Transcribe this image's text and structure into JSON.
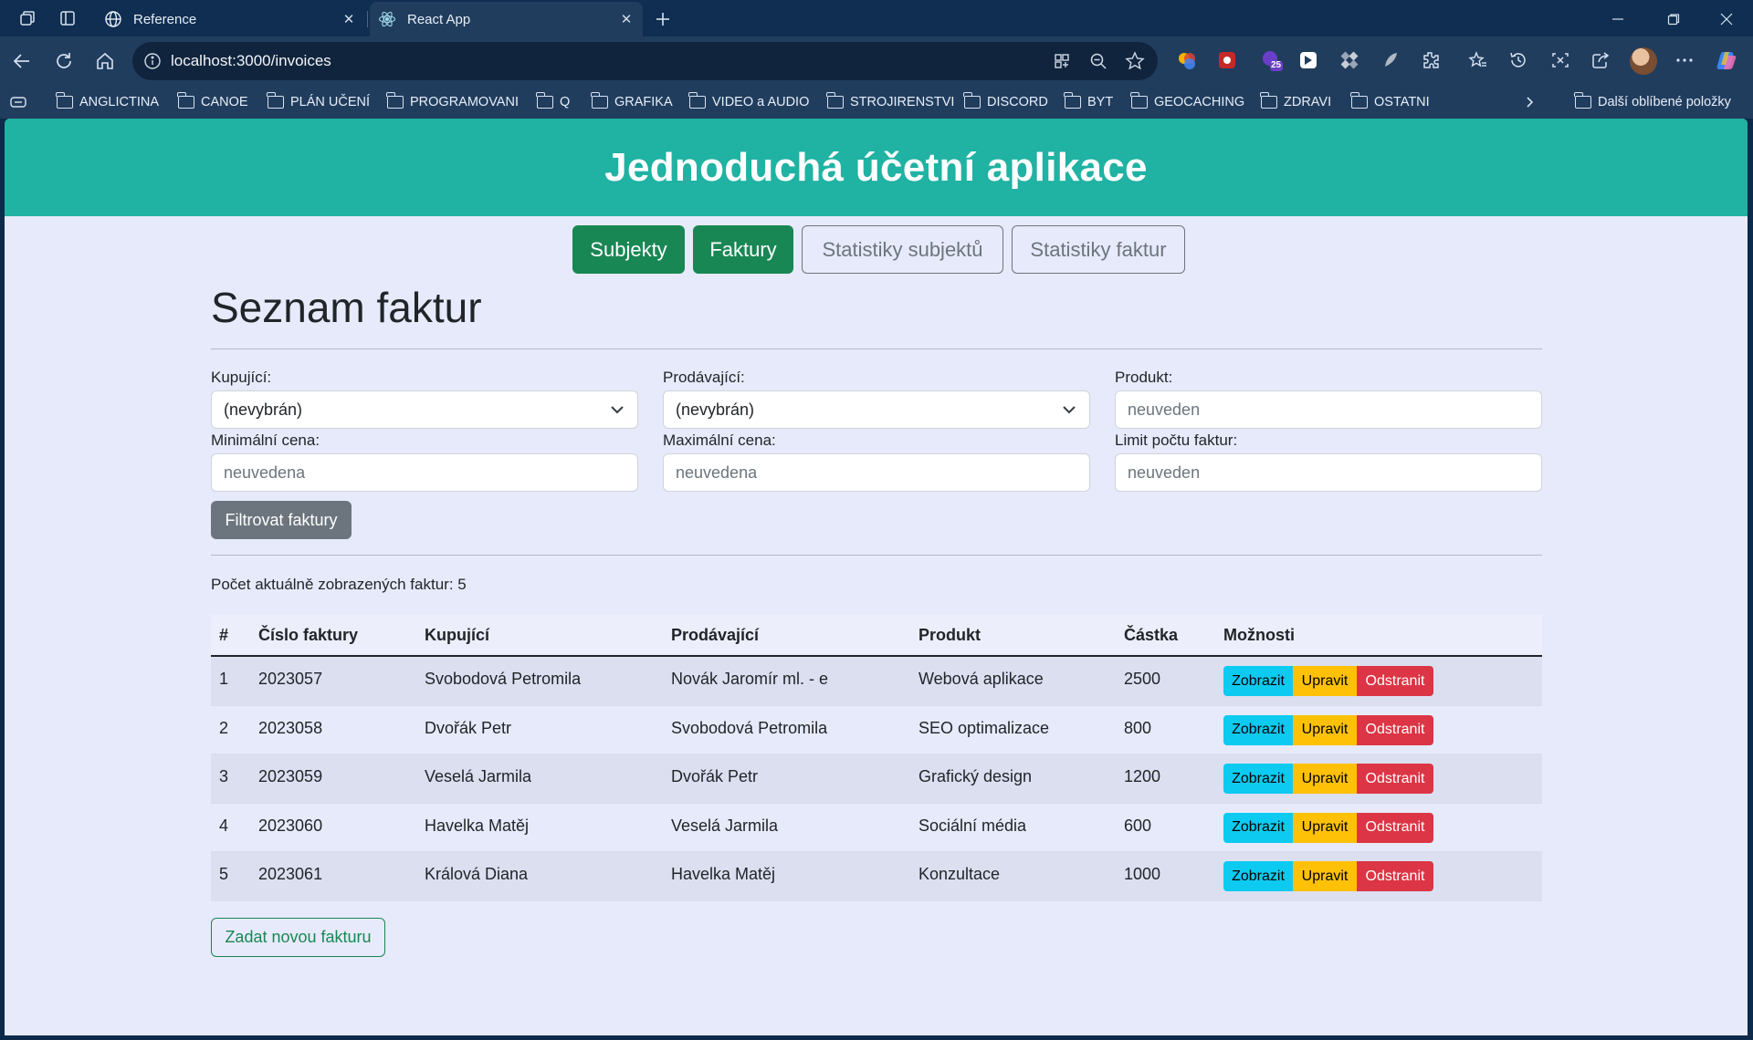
{
  "browser": {
    "tabs": [
      {
        "label": "Reference",
        "icon": "globe-icon",
        "active": false
      },
      {
        "label": "React App",
        "icon": "react-icon",
        "active": true
      }
    ],
    "address": "localhost:3000/invoices",
    "bookmarks": [
      "ANGLICTINA",
      "CANOE",
      "PLÁN UČENÍ",
      "PROGRAMOVANI",
      "Q",
      "GRAFIKA",
      "VIDEO a AUDIO",
      "STROJIRENSTVI",
      "DISCORD",
      "BYT",
      "GEOCACHING",
      "ZDRAVI",
      "OSTATNI"
    ],
    "other_bookmarks": "Další oblíbené položky",
    "extension_badge": "25"
  },
  "app": {
    "title": "Jednoduchá účetní aplikace",
    "nav": [
      "Subjekty",
      "Faktury",
      "Statistiky subjektů",
      "Statistiky faktur"
    ],
    "accent": "#198754",
    "header_color": "#20b2a2"
  },
  "page": {
    "heading": "Seznam faktur",
    "filters": {
      "buyer_label": "Kupující:",
      "buyer_value": "(nevybrán)",
      "seller_label": "Prodávající:",
      "seller_value": "(nevybrán)",
      "product_label": "Produkt:",
      "product_placeholder": "neuveden",
      "min_price_label": "Minimální cena:",
      "min_price_placeholder": "neuvedena",
      "max_price_label": "Maximální cena:",
      "max_price_placeholder": "neuvedena",
      "limit_label": "Limit počtu faktur:",
      "limit_placeholder": "neuveden",
      "submit": "Filtrovat faktury"
    },
    "count_text": "Počet aktuálně zobrazených faktur: 5",
    "table": {
      "headers": [
        "#",
        "Číslo faktury",
        "Kupující",
        "Prodávající",
        "Produkt",
        "Částka",
        "Možnosti"
      ],
      "rows": [
        [
          "1",
          "2023057",
          "Svobodová Petromila",
          "Novák Jaromír ml. - e",
          "Webová aplikace",
          "2500"
        ],
        [
          "2",
          "2023058",
          "Dvořák Petr",
          "Svobodová Petromila",
          "SEO optimalizace",
          "800"
        ],
        [
          "3",
          "2023059",
          "Veselá Jarmila",
          "Dvořák Petr",
          "Grafický design",
          "1200"
        ],
        [
          "4",
          "2023060",
          "Havelka Matěj",
          "Veselá Jarmila",
          "Sociální média",
          "600"
        ],
        [
          "5",
          "2023061",
          "Králová Diana",
          "Havelka Matěj",
          "Konzultace",
          "1000"
        ]
      ],
      "actions": {
        "show": "Zobrazit",
        "edit": "Upravit",
        "delete": "Odstranit"
      }
    },
    "new_invoice": "Zadat novou fakturu"
  }
}
